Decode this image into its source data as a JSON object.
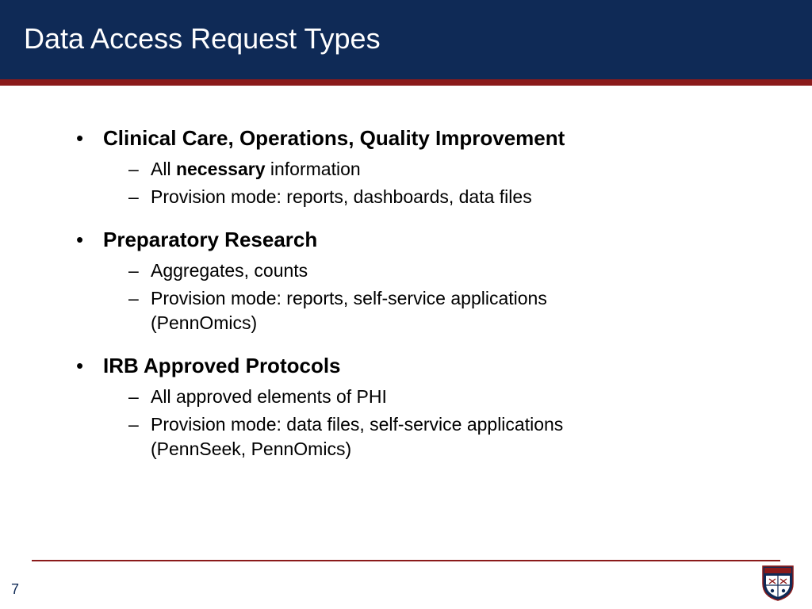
{
  "header": {
    "title": "Data Access Request Types"
  },
  "items": [
    {
      "heading": "Clinical Care, Operations, Quality Improvement",
      "sub": [
        {
          "prefix": "All ",
          "bold": "necessary",
          "suffix": " information"
        },
        {
          "text": "Provision mode: reports, dashboards, data files"
        }
      ]
    },
    {
      "heading": "Preparatory Research",
      "sub": [
        {
          "text": "Aggregates, counts"
        },
        {
          "text": "Provision mode: reports, self-service applications (PennOmics)"
        }
      ]
    },
    {
      "heading": "IRB Approved Protocols",
      "sub": [
        {
          "text": "All approved elements of PHI"
        },
        {
          "text": "Provision mode: data files, self-service applications (PennSeek, PennOmics)"
        }
      ]
    }
  ],
  "footer": {
    "page_number": "7"
  }
}
